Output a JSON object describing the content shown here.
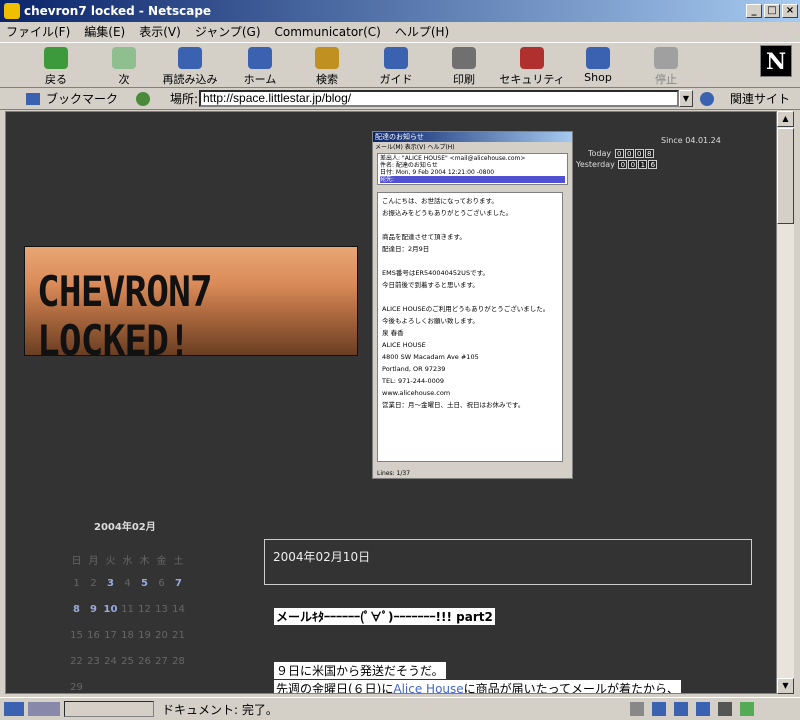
{
  "window": {
    "title": "chevron7 locked - Netscape"
  },
  "menu": [
    "ファイル(F)",
    "編集(E)",
    "表示(V)",
    "ジャンプ(G)",
    "Communicator(C)",
    "ヘルプ(H)"
  ],
  "toolbar": [
    {
      "label": "戻る",
      "icon": "back-arrow-icon",
      "color": "#3c9a3c"
    },
    {
      "label": "次",
      "icon": "forward-arrow-icon",
      "color": "#8fbf8f"
    },
    {
      "label": "再読み込み",
      "icon": "reload-icon",
      "color": "#3a62b0"
    },
    {
      "label": "ホーム",
      "icon": "home-icon",
      "color": "#3a62b0"
    },
    {
      "label": "検索",
      "icon": "search-icon",
      "color": "#c09020"
    },
    {
      "label": "ガイド",
      "icon": "guide-icon",
      "color": "#3a62b0"
    },
    {
      "label": "印刷",
      "icon": "print-icon",
      "color": "#707070"
    },
    {
      "label": "セキュリティ",
      "icon": "lock-icon",
      "color": "#b03030"
    },
    {
      "label": "Shop",
      "icon": "shop-icon",
      "color": "#3a62b0"
    },
    {
      "label": "停止",
      "icon": "stop-icon",
      "color": "#a0a0a0"
    }
  ],
  "location": {
    "bookmark": "ブックマーク",
    "label": "場所:",
    "url": "http://space.littlestar.jp/blog/",
    "related": "関連サイト"
  },
  "status": {
    "text": "ドキュメント: 完了。"
  },
  "page": {
    "banner_text": "CHEVRON7 LOCKED!",
    "counter": {
      "since": "Since 04.01.24",
      "today_label": "Today",
      "today_digits": [
        "0",
        "0",
        "0",
        "8"
      ],
      "yesterday_label": "Yesterday",
      "yesterday_digits": [
        "0",
        "0",
        "1",
        "6"
      ]
    },
    "screenshot": {
      "title": "配達のお知らせ",
      "menu": "メール(M)  表示(V)  ヘルプ(H)",
      "header_from": "差出人: \"ALICE HOUSE\" <mail@alicehouse.com>",
      "header_subject": "件名: 配達のお知らせ",
      "header_date": "日付: Mon, 9 Feb 2004 12:21:00 -0800",
      "header_to": "宛先:",
      "lines": [
        "こんにちは、お世話になっております。",
        "お振込みをどうもありがとうございました。",
        "",
        "商品を配達させて頂きます。",
        "配達日：2月9日",
        "",
        "EMS番号はER540040452USです。",
        "今日前後で到着すると思います。",
        "",
        "ALICE HOUSEのご利用どうもありがとうございました。",
        "今後もよろしくお願い致します。",
        "泉 春香",
        "ALICE HOUSE",
        "4800 SW Macadam Ave #105",
        "Portland, OR 97239",
        "TEL: 971-244-0009",
        "www.alicehouse.com",
        "営業日：月～金曜日、土日、祝日はお休みです。"
      ],
      "status": "Lines: 1/37"
    },
    "calendar": {
      "title": "2004年02月",
      "weekdays": [
        "日",
        "月",
        "火",
        "水",
        "木",
        "金",
        "土"
      ],
      "weeks": [
        [
          "1",
          "2",
          "3",
          "4",
          "5",
          "6",
          "7"
        ],
        [
          "8",
          "9",
          "10",
          "11",
          "12",
          "13",
          "14"
        ],
        [
          "15",
          "16",
          "17",
          "18",
          "19",
          "20",
          "21"
        ],
        [
          "22",
          "23",
          "24",
          "25",
          "26",
          "27",
          "28"
        ],
        [
          "29",
          "",
          "",
          "",
          "",
          "",
          ""
        ]
      ]
    },
    "date_header": "2004年02月10日",
    "entry_title": "メールｷﾀｰｰｰｰｰｰ(ﾟ∀ﾟ)ｰｰｰｰｰｰｰ!!! part2",
    "entry_line1": "９日に米国から発送だそうだ。",
    "entry_line2_a": "先週の金曜日(６日)に",
    "entry_line2_link": "Alice House",
    "entry_line2_b": "に商品が届いたってメールが着たから、"
  }
}
